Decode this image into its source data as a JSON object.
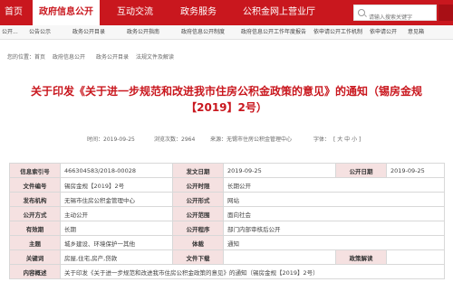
{
  "nav": {
    "items": [
      {
        "label": "首页"
      },
      {
        "label": "政府信息公开"
      },
      {
        "label": "互动交流"
      },
      {
        "label": "政务服务"
      },
      {
        "label": "公积金网上营业厅"
      }
    ],
    "search": {
      "placeholder": "请输入搜索关键字"
    }
  },
  "subnav": {
    "items": [
      "公开...",
      "公告公示",
      "政务公开目录",
      "政务公开指南",
      "政府信息公开制度",
      "政府信息公开工作年度报告",
      "依申请公开工作机制",
      "依申请公开",
      "意见箱"
    ]
  },
  "breadcrumb": [
    "您的位置：",
    "首页",
    "政府信息公开",
    "政务公开目录",
    "法规文件及解读"
  ],
  "article": {
    "title_line1": "关于印发《关于进一步规范和改进我市住房公积金政策的意见》的通知（锡房金规",
    "title_line2": "【2019】2号）",
    "date_label": "时间：2019-09-25",
    "views_label": "浏览次数：2964",
    "source_label": "来源：无锡市住房公积金管理中心",
    "font_label": "字体：",
    "font_size_label": "[ 大 中 小 ]"
  },
  "info_table": {
    "rows": [
      {
        "k1": "信息索引号",
        "v1": "466304583/2018-00028",
        "k2": "发文日期",
        "v2": "2019-09-25",
        "k3": "公开日期",
        "v3": "2019-09-25"
      },
      {
        "k1": "文件编号",
        "v1": "锡房金规【2019】2号",
        "k2": "公开时限",
        "v2": "长期公开"
      },
      {
        "k1": "发布机构",
        "v1": "无锡市住房公积金管理中心",
        "k2": "公开形式",
        "v2": "网站"
      },
      {
        "k1": "公开方式",
        "v1": "主动公开",
        "k2": "公开范围",
        "v2": "面向社会"
      },
      {
        "k1": "有效期",
        "v1": "长期",
        "k2": "公开程序",
        "v2": "部门内部审核后公开"
      },
      {
        "k1": "主题",
        "v1": "城乡建设、环境保护一其他",
        "k2": "体裁",
        "v2": "通知"
      },
      {
        "k1": "关键词",
        "v1": "房屋,住宅,房产,贷款",
        "k2": "文件下载",
        "v2": "",
        "k3": "政策解读",
        "v3": ""
      }
    ],
    "content_label": "内容概述",
    "content_value": "关于印发《关于进一步规范和改进我市住房公积金政策的意见》的通知（锡房金规【2019】2号）"
  }
}
